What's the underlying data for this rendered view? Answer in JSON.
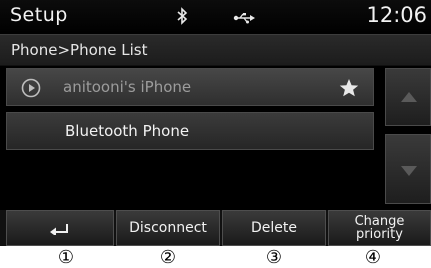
{
  "statusbar": {
    "title": "Setup",
    "clock": "12:06",
    "icons": [
      "bluetooth-icon",
      "usb-icon"
    ]
  },
  "breadcrumb": "Phone>Phone List",
  "phone_list": [
    {
      "name": "anitooni's iPhone",
      "selected": true,
      "icon": "play-circle-icon",
      "favorite": true
    },
    {
      "name": "Bluetooth Phone",
      "selected": false
    }
  ],
  "scroll": {
    "up_icon": "triangle-up-icon",
    "down_icon": "triangle-down-icon"
  },
  "bottom_buttons": {
    "back_icon": "back-arrow-icon",
    "disconnect": "Disconnect",
    "delete": "Delete",
    "change_priority": "Change priority",
    "change_priority_line1": "Change",
    "change_priority_line2": "priority"
  },
  "markers": [
    "①",
    "②",
    "③",
    "④"
  ]
}
